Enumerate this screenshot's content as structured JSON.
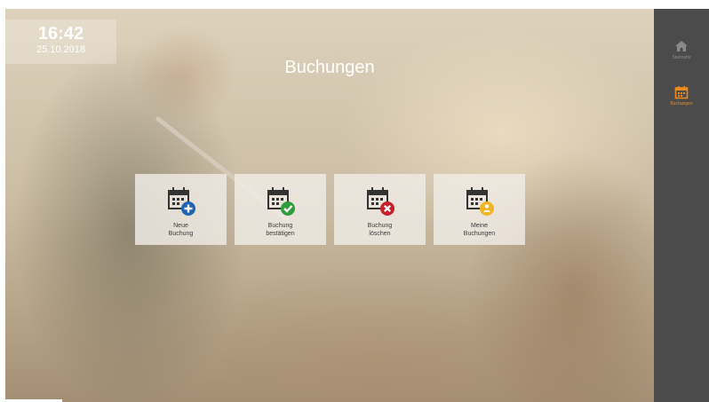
{
  "clock": {
    "time": "16:42",
    "date": "25.10.2018"
  },
  "page": {
    "title": "Buchungen"
  },
  "tiles": [
    {
      "line1": "Neue",
      "line2": "Buchung",
      "badge_icon": "plus-icon",
      "badge_color": "#1f63b4"
    },
    {
      "line1": "Buchung",
      "line2": "bestätigen",
      "badge_icon": "check-icon",
      "badge_color": "#2f9e3a"
    },
    {
      "line1": "Buchung",
      "line2": "löschen",
      "badge_icon": "x-icon",
      "badge_color": "#c8202a"
    },
    {
      "line1": "Meine",
      "line2": "Buchungen",
      "badge_icon": "person-icon",
      "badge_color": "#f5b324"
    }
  ],
  "sidebar": {
    "items": [
      {
        "label": "Startseite",
        "icon": "home-icon",
        "color": "#8a8a8a"
      },
      {
        "label": "Buchungen",
        "icon": "calendar-icon",
        "color": "#f08a1c"
      }
    ]
  }
}
